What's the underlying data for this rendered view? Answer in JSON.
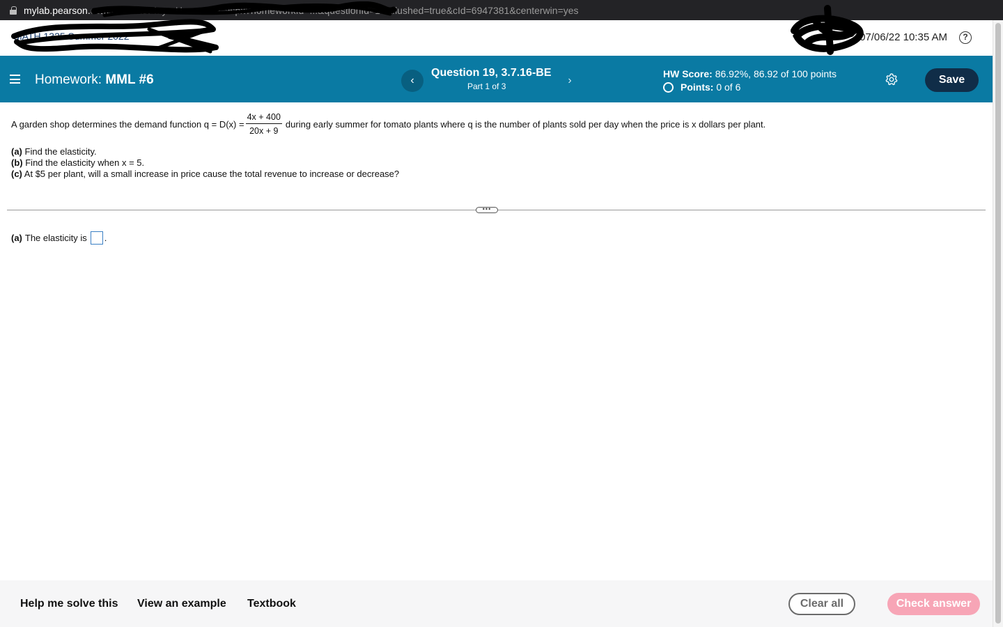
{
  "browser": {
    "url_host": "mylab.pearson.com",
    "url_path": "/Student/PlayerHomework.aspx?homeworkId=...&questionId=19&flushed=true&cId=6947381&centerwin=yes"
  },
  "topbar": {
    "course_title": "MATH 1325 Summer 2022",
    "datetime": "07/06/22 10:35 AM",
    "help_glyph": "?"
  },
  "header": {
    "hw_label": "Homework:",
    "hw_name": "MML #6",
    "question_title": "Question 19, 3.7.16-BE",
    "question_part": "Part 1 of 3",
    "hw_score_label": "HW Score:",
    "hw_score_value": "86.92%, 86.92 of 100 points",
    "points_label": "Points:",
    "points_value": "0 of 6",
    "save_label": "Save",
    "prev_glyph": "‹",
    "next_glyph": "›"
  },
  "question": {
    "intro": "A garden shop determines the demand function q = D(x) =",
    "frac_num": "4x + 400",
    "frac_den": "20x + 9",
    "outro": "during early summer for tomato plants where q is the number of plants sold per day when the price is x dollars per plant.",
    "parts": [
      {
        "label": "(a)",
        "text": "Find the elasticity."
      },
      {
        "label": "(b)",
        "text": "Find the elasticity when x = 5."
      },
      {
        "label": "(c)",
        "text": "At $5 per plant, will a small increase in price cause the total revenue to increase or decrease?"
      }
    ]
  },
  "answer": {
    "label": "(a)",
    "text": "The elasticity is",
    "value": "",
    "suffix": "."
  },
  "divider_handle": "•••",
  "bottom": {
    "help_me_solve": "Help me solve this",
    "view_example": "View an example",
    "textbook": "Textbook",
    "clear_all": "Clear all",
    "check_answer": "Check answer"
  },
  "colors": {
    "header_bg": "#0a7aa3",
    "save_bg": "#102d48",
    "check_bg": "#f7a5b6"
  }
}
